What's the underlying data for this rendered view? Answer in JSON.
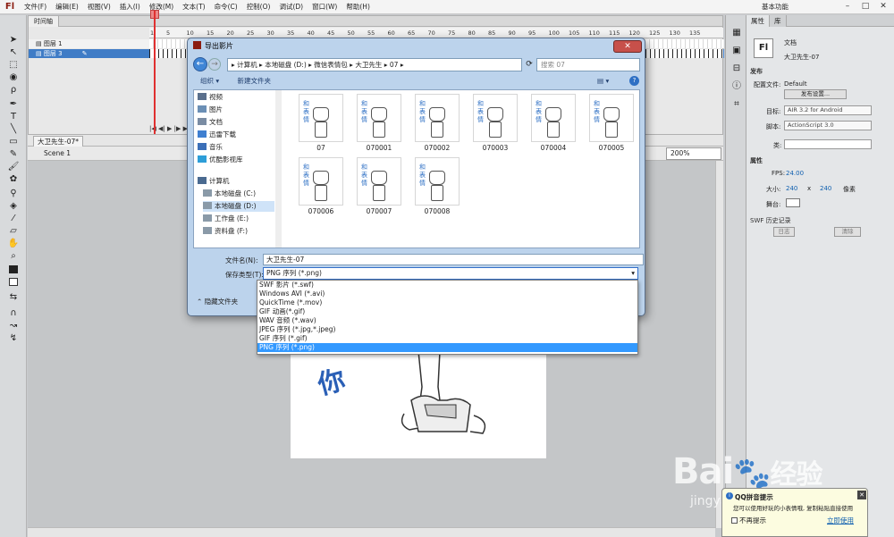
{
  "app": {
    "logo": "Fl",
    "workspace": "基本功能"
  },
  "menus": [
    "文件(F)",
    "编辑(E)",
    "视图(V)",
    "插入(I)",
    "修改(M)",
    "文本(T)",
    "命令(C)",
    "控制(O)",
    "调试(D)",
    "窗口(W)",
    "帮助(H)"
  ],
  "timeline": {
    "tab": "时间轴",
    "ruler": [
      "1",
      "5",
      "10",
      "15",
      "20",
      "25",
      "30",
      "35",
      "40",
      "45",
      "50",
      "55",
      "60",
      "65",
      "70",
      "75",
      "80",
      "85",
      "90",
      "95",
      "100",
      "105",
      "110",
      "115",
      "120",
      "125",
      "130",
      "135"
    ],
    "layers": [
      {
        "name": "图层 1"
      },
      {
        "name": "图层 3"
      }
    ]
  },
  "stage": {
    "doc_tab": "大卫先生-07*",
    "scene": "Scene 1",
    "zoom": "200%"
  },
  "properties": {
    "tabs": [
      "属性",
      "库"
    ],
    "doc_label": "文档",
    "doc_name": "大卫先生-07",
    "publish_section": "发布",
    "config_label": "配置文件:",
    "config_value": "Default",
    "publish_settings_btn": "发布设置...",
    "target_label": "目标:",
    "target_value": "AIR 3.2 for Android",
    "script_label": "脚本:",
    "script_value": "ActionScript 3.0",
    "class_label": "类:",
    "attr_section": "属性",
    "fps_label": "FPS:",
    "fps_value": "24.00",
    "size_label": "大小:",
    "width": "240",
    "x": "x",
    "height": "240",
    "unit": "像素",
    "stage_label": "舞台:",
    "swf_section": "SWF 历史记录",
    "log_btn": "日志",
    "clear_btn": "清除"
  },
  "dialog": {
    "title": "导出影片",
    "address": [
      "计算机",
      "本地磁盘 (D:)",
      "微信表情包",
      "大卫先生",
      "07"
    ],
    "search_placeholder": "搜索 07",
    "organize": "组织 ▾",
    "new_folder": "新建文件夹",
    "nav": [
      {
        "label": "视频",
        "color": "#5a6f8c"
      },
      {
        "label": "图片",
        "color": "#6b8fb5"
      },
      {
        "label": "文档",
        "color": "#7a8ca3"
      },
      {
        "label": "迅雷下载",
        "color": "#3f7fd0"
      },
      {
        "label": "音乐",
        "color": "#3b6fb8"
      },
      {
        "label": "优酷影视库",
        "color": "#2d9ed8"
      },
      {
        "label": "计算机",
        "color": "#4a6a90"
      },
      {
        "label": "本地磁盘 (C:)",
        "color": "#8a9aa8"
      },
      {
        "label": "本地磁盘 (D:)",
        "color": "#8a9aa8"
      },
      {
        "label": "工作盘 (E:)",
        "color": "#8a9aa8"
      },
      {
        "label": "资料盘 (F:)",
        "color": "#8a9aa8"
      }
    ],
    "files": [
      "07",
      "070001",
      "070002",
      "070003",
      "070004",
      "070005",
      "070006",
      "070007",
      "070008"
    ],
    "filename_label": "文件名(N):",
    "filename_value": "大卫先生-07",
    "filetype_label": "保存类型(T):",
    "filetype_value": "PNG 序列 (*.png)",
    "hide_folders": "隐藏文件夹",
    "options": [
      "SWF 影片 (*.swf)",
      "Windows AVI (*.avi)",
      "QuickTime (*.mov)",
      "GIF 动画(*.gif)",
      "WAV 音频 (*.wav)",
      "JPEG 序列 (*.jpg,*.jpeg)",
      "GIF 序列 (*.gif)",
      "PNG 序列 (*.png)"
    ],
    "selected_option_index": 7
  },
  "canvas_text": "你",
  "watermark": {
    "brand": "Bai",
    "brand2": "经验",
    "url": "jingyan"
  },
  "qq": {
    "title": "QQ拼音提示",
    "body": "您可以使用好玩的小表情哦, 复制粘贴直接使用",
    "no_show": "不再提示",
    "link": "立即使用"
  }
}
